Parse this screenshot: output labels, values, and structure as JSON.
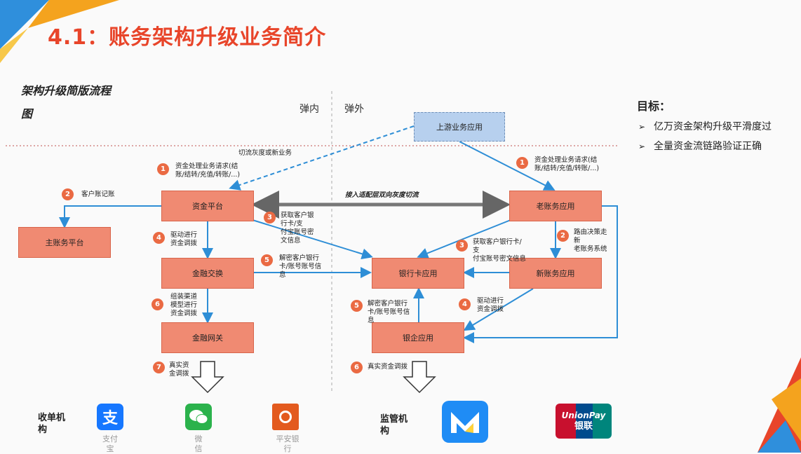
{
  "title": "4.1：账务架构升级业务简介",
  "diagram": {
    "title": "架构升级简版流程\n图",
    "zone_inner": "弹内",
    "zone_outer": "弹外",
    "nodes": {
      "upstream": "上游业务应用",
      "capital": "资金平台",
      "main_account": "主账务平台",
      "finance_exchange": "金融交换",
      "finance_gateway": "金融网关",
      "bank_card": "银行卡应用",
      "bank_enterprise": "银企应用",
      "old_account": "老账务应用",
      "new_account": "新账务应用"
    },
    "labels": {
      "cut_traffic": "切流灰度或新业务",
      "left_req": "资金处理业务请求(结\n账/结转/充值/转账/...)",
      "right_req": "资金处理业务请求(结\n账/结转/充值/转账/...)",
      "customer_book": "客户账记账",
      "adapter": "接入适配层双向灰度切流",
      "left_get_card": "获取客户银\n行卡/支\n付宝账号密\n文信息",
      "left_drive": "驱动进行\n资金调拨",
      "left_decrypt": "解密客户银行\n卡/账号账号信\n息",
      "left_assemble": "组装渠道\n模型进行\n资金调拨",
      "left_real": "真实资\n金调拨",
      "route": "路由决策走\n新\n老账务系统",
      "right_get_card": "获取客户银行卡/\n支\n付宝账号密文信息",
      "right_drive": "驱动进行\n资金调拨",
      "right_decrypt": "解密客户银行\n卡/账号账号信\n息",
      "right_real": "真实资金调拨"
    },
    "step_numbers": {
      "s1_left": "1",
      "s2_left": "2",
      "s3_left": "3",
      "s4_left": "4",
      "s5_left": "5",
      "s6_left": "6",
      "s7_left": "7",
      "s1_right": "1",
      "s2_right": "2",
      "s3_right": "3",
      "s4_right": "4",
      "s5_right": "5",
      "s6_right": "6"
    }
  },
  "goals": {
    "title": "目标：",
    "items": [
      "亿万资金架构升级平滑度过",
      "全量资金流链路验证正确"
    ]
  },
  "bottom": {
    "acquirer_label": "收单机\n构",
    "regulator_label": "监管机\n构",
    "logos": {
      "alipay_caption": "支付\n宝",
      "wechat_caption": "微\n信",
      "pingan_caption": "平安银\n行",
      "unionpay_text": "UnionPay",
      "unionpay_cn": "银联"
    },
    "colors": {
      "alipay": "#1677ff",
      "wechat": "#2bb24c",
      "pingan": "#e35a1e",
      "regulator": "#1f8cf5",
      "unionpay": "#c8102e"
    }
  }
}
